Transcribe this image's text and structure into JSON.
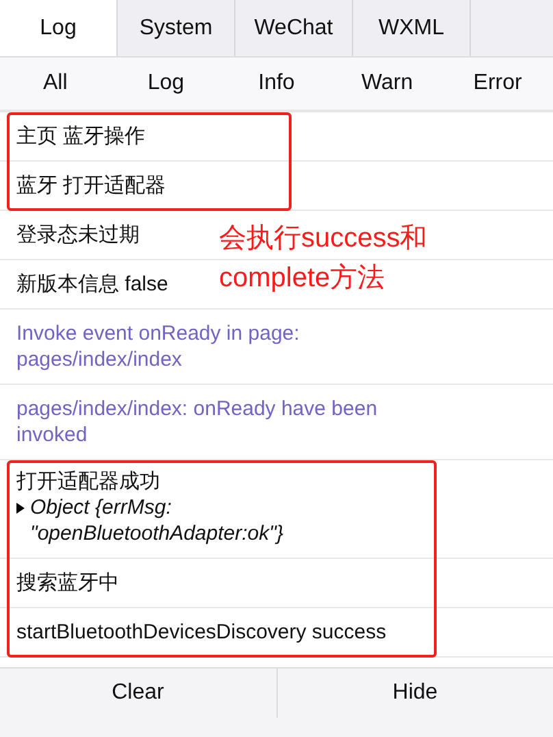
{
  "tabs": [
    {
      "label": "Log",
      "selected": true
    },
    {
      "label": "System",
      "selected": false
    },
    {
      "label": "WeChat",
      "selected": false
    },
    {
      "label": "WXML",
      "selected": false
    }
  ],
  "filters": [
    "All",
    "Log",
    "Info",
    "Warn",
    "Error"
  ],
  "logs": [
    {
      "kind": "log",
      "text": "主页 蓝牙操作",
      "highlighted": true
    },
    {
      "kind": "log",
      "text": "蓝牙 打开适配器",
      "highlighted": true
    },
    {
      "kind": "log",
      "text": "登录态未过期",
      "highlighted": false
    },
    {
      "kind": "log",
      "text": "新版本信息 false",
      "highlighted": false
    },
    {
      "kind": "system",
      "text": "Invoke event onReady in page: pages/index/index",
      "highlighted": false
    },
    {
      "kind": "system",
      "text": "pages/index/index: onReady have been invoked",
      "highlighted": false
    },
    {
      "kind": "object",
      "text": "打开适配器成功",
      "object": "Object {errMsg: \"openBluetoothAdapter:ok\"}",
      "highlighted": true
    },
    {
      "kind": "log",
      "text": "搜索蓝牙中",
      "highlighted": true
    },
    {
      "kind": "log",
      "text": "startBluetoothDevicesDiscovery success",
      "highlighted": true
    }
  ],
  "annotation_note": "会执行success和complete方法",
  "buttons": [
    "Clear",
    "Hide"
  ]
}
